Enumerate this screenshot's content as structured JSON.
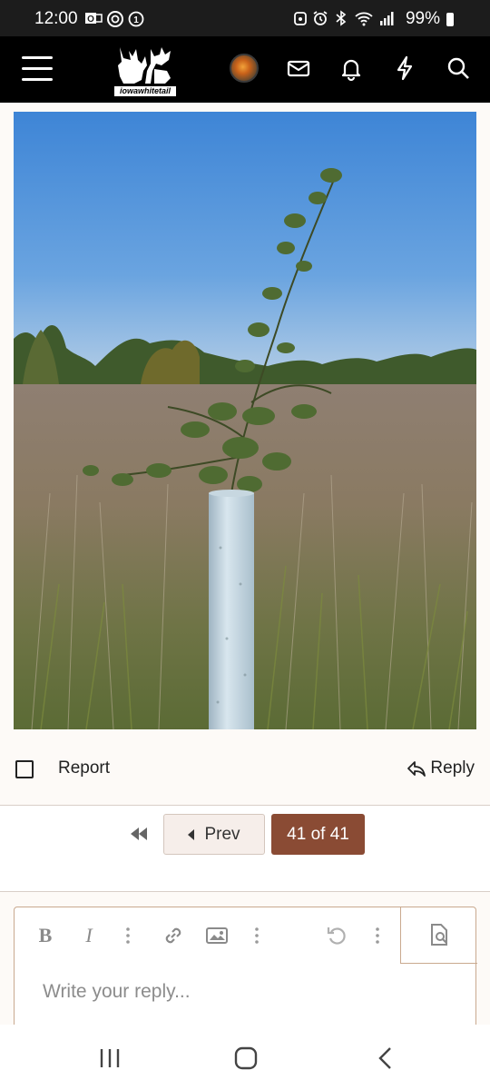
{
  "status_bar": {
    "time": "12:00",
    "battery_percent": "99%",
    "left_icons": [
      "outlook-icon",
      "at-circle-icon",
      "badge-1-icon"
    ],
    "right_icons": [
      "alarm-icon",
      "alarm-clock-icon",
      "bluetooth-icon",
      "wifi-icon",
      "signal-icon",
      "battery-icon"
    ]
  },
  "nav": {
    "logo_text": "iowawhitetail",
    "icons": [
      "menu-icon",
      "avatar",
      "envelope-icon",
      "bell-icon",
      "bolt-icon",
      "search-icon"
    ]
  },
  "post": {
    "image_alt": "",
    "report_label": "Report",
    "reply_label": "Reply"
  },
  "pagination": {
    "prev_label": "Prev",
    "current_label": "41 of 41",
    "current_color": "#8a4b34"
  },
  "editor": {
    "placeholder": "Write your reply...",
    "toolbar": [
      "bold",
      "italic",
      "more",
      "link",
      "image",
      "more",
      "undo",
      "more",
      "preview"
    ]
  },
  "colors": {
    "nav_background": "#000000",
    "accent": "#8a4b34",
    "editor_border": "#c9a98f"
  }
}
